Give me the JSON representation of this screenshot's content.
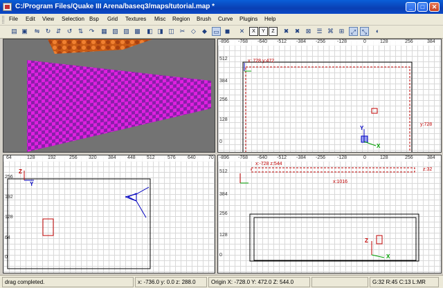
{
  "window": {
    "title": "C:/Program Files/Quake III Arena/baseq3/maps/tutorial.map *"
  },
  "menu": [
    "File",
    "Edit",
    "View",
    "Selection",
    "Bsp",
    "Grid",
    "Textures",
    "Misc",
    "Region",
    "Brush",
    "Curve",
    "Plugins",
    "Help"
  ],
  "toolbar": {
    "x_label": "X",
    "y_label": "Y",
    "z_label": "Z"
  },
  "view_xy": {
    "ruler": [
      "-896",
      "-768",
      "-640",
      "-512",
      "-384",
      "-256",
      "-128",
      "0",
      "128",
      "256",
      "384"
    ],
    "vruler": [
      "512",
      "384",
      "256",
      "128",
      "0"
    ],
    "coord": "x: 728  y:472",
    "size": "y:728",
    "axes": {
      "vert": "Y",
      "horiz": "X"
    }
  },
  "view_yz": {
    "ruler": [
      "64",
      "128",
      "192",
      "256",
      "320",
      "384",
      "448",
      "512",
      "576",
      "640",
      "70"
    ],
    "vruler": [
      "256",
      "192",
      "128",
      "64",
      "0"
    ],
    "axes": {
      "vert": "Z",
      "horiz": "Y"
    }
  },
  "view_xz": {
    "ruler": [
      "-896",
      "-768",
      "-640",
      "-512",
      "-384",
      "-256",
      "-128",
      "0",
      "128",
      "256",
      "384"
    ],
    "vruler": [
      "512",
      "384",
      "256",
      "128",
      "0"
    ],
    "coord": "x:-728  z:544",
    "width": "x:1016",
    "height": "z:32",
    "axes": {
      "vert": "Z",
      "horiz": "X"
    }
  },
  "status": {
    "message": "drag completed.",
    "cursor": "x: -736.0  y: 0.0  z: 288.0",
    "origin": "Origin X: -728.0  Y: 472.0  Z: 544.0",
    "grid": "G:32 R:45 C:13 L:MR"
  },
  "colors": {
    "title_bar": "#0a3fb3",
    "checker_a": "#e020e0",
    "checker_b": "#8820a8",
    "selection": "#c00000",
    "axis_x": "#00a000",
    "axis_y": "#0000c0",
    "axis_z": "#c00000"
  }
}
